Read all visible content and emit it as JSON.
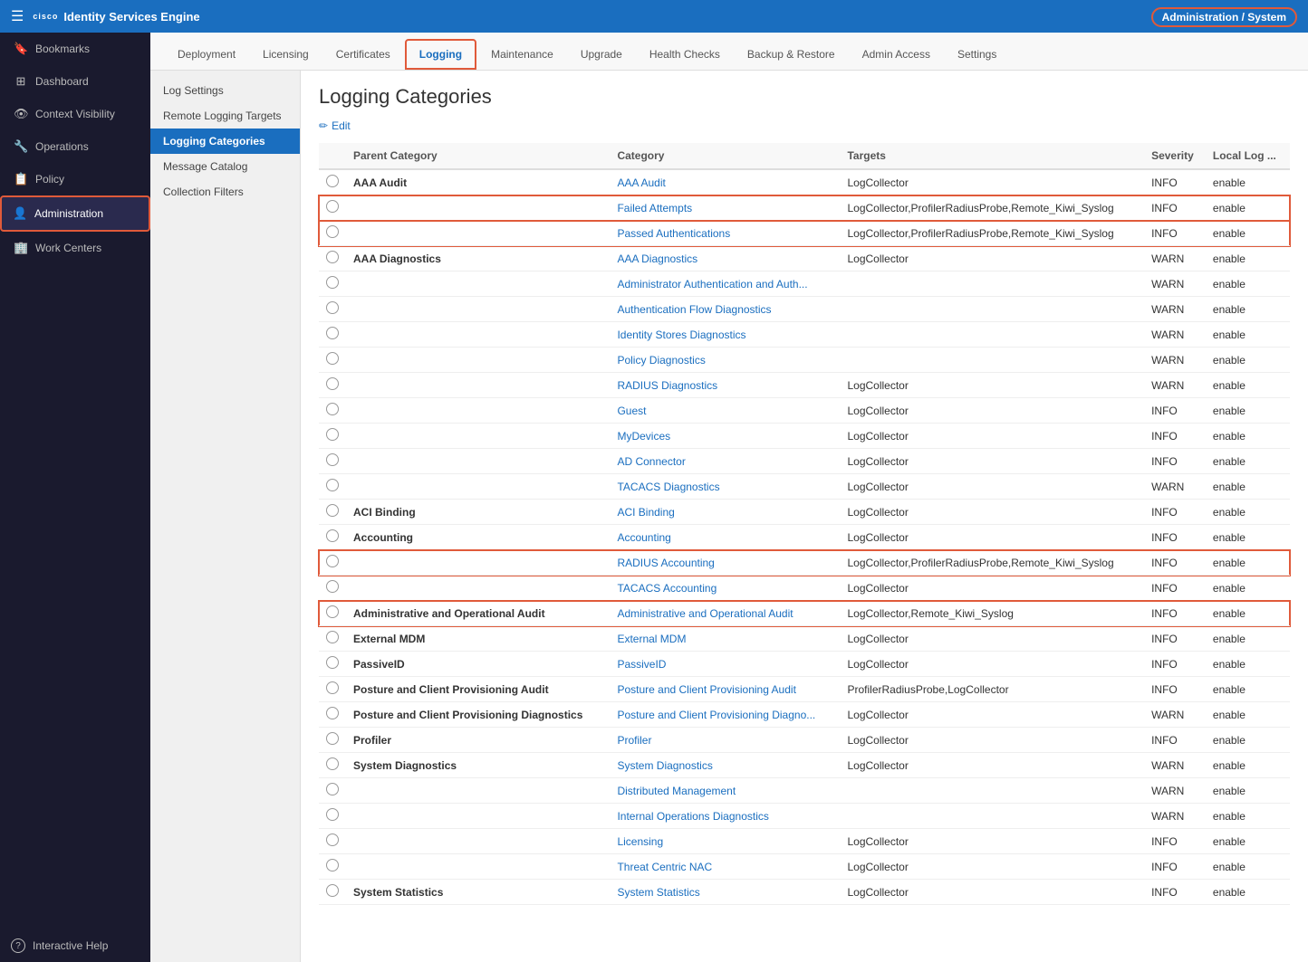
{
  "topBar": {
    "appName": "Identity Services Engine",
    "adminLabel": "Administration / System",
    "hamburgerSymbol": "☰",
    "ciscoLabel": "cisco"
  },
  "sidebar": {
    "items": [
      {
        "id": "bookmarks",
        "label": "Bookmarks",
        "icon": "🔖"
      },
      {
        "id": "dashboard",
        "label": "Dashboard",
        "icon": "⊞"
      },
      {
        "id": "context-visibility",
        "label": "Context Visibility",
        "icon": "👁"
      },
      {
        "id": "operations",
        "label": "Operations",
        "icon": "🔧"
      },
      {
        "id": "policy",
        "label": "Policy",
        "icon": "📋"
      },
      {
        "id": "administration",
        "label": "Administration",
        "icon": "👤",
        "active": true,
        "highlighted": true
      },
      {
        "id": "work-centers",
        "label": "Work Centers",
        "icon": "🏢"
      }
    ],
    "helpLabel": "Interactive Help",
    "helpIcon": "?"
  },
  "tabs": [
    {
      "id": "deployment",
      "label": "Deployment"
    },
    {
      "id": "licensing",
      "label": "Licensing"
    },
    {
      "id": "certificates",
      "label": "Certificates"
    },
    {
      "id": "logging",
      "label": "Logging",
      "active": true
    },
    {
      "id": "maintenance",
      "label": "Maintenance"
    },
    {
      "id": "upgrade",
      "label": "Upgrade"
    },
    {
      "id": "health-checks",
      "label": "Health Checks"
    },
    {
      "id": "backup-restore",
      "label": "Backup & Restore"
    },
    {
      "id": "admin-access",
      "label": "Admin Access"
    },
    {
      "id": "settings",
      "label": "Settings"
    }
  ],
  "subNav": {
    "items": [
      {
        "id": "log-settings",
        "label": "Log Settings"
      },
      {
        "id": "remote-logging",
        "label": "Remote Logging Targets"
      },
      {
        "id": "logging-categories",
        "label": "Logging Categories",
        "active": true
      },
      {
        "id": "message-catalog",
        "label": "Message Catalog"
      },
      {
        "id": "collection-filters",
        "label": "Collection Filters"
      }
    ]
  },
  "pageTitle": "Logging Categories",
  "editLabel": "Edit",
  "table": {
    "columns": [
      "",
      "Parent Category",
      "Category",
      "Targets",
      "Severity",
      "Local Log ..."
    ],
    "rows": [
      {
        "radio": true,
        "parent": "AAA Audit",
        "category": "AAA Audit",
        "targets": "LogCollector",
        "severity": "INFO",
        "localLog": "enable",
        "highlighted": false,
        "parentBold": true
      },
      {
        "radio": true,
        "parent": "",
        "category": "Failed Attempts",
        "targets": "LogCollector,ProfilerRadiusProbe,Remote_Kiwi_Syslog",
        "severity": "INFO",
        "localLog": "enable",
        "highlighted": true
      },
      {
        "radio": true,
        "parent": "",
        "category": "Passed Authentications",
        "targets": "LogCollector,ProfilerRadiusProbe,Remote_Kiwi_Syslog",
        "severity": "INFO",
        "localLog": "enable",
        "highlighted": true
      },
      {
        "radio": true,
        "parent": "AAA Diagnostics",
        "category": "AAA Diagnostics",
        "targets": "LogCollector",
        "severity": "WARN",
        "localLog": "enable",
        "highlighted": false,
        "parentBold": true
      },
      {
        "radio": true,
        "parent": "",
        "category": "Administrator Authentication and Auth...",
        "targets": "",
        "severity": "WARN",
        "localLog": "enable",
        "highlighted": false
      },
      {
        "radio": true,
        "parent": "",
        "category": "Authentication Flow Diagnostics",
        "targets": "",
        "severity": "WARN",
        "localLog": "enable",
        "highlighted": false
      },
      {
        "radio": true,
        "parent": "",
        "category": "Identity Stores Diagnostics",
        "targets": "",
        "severity": "WARN",
        "localLog": "enable",
        "highlighted": false
      },
      {
        "radio": true,
        "parent": "",
        "category": "Policy Diagnostics",
        "targets": "",
        "severity": "WARN",
        "localLog": "enable",
        "highlighted": false
      },
      {
        "radio": true,
        "parent": "",
        "category": "RADIUS Diagnostics",
        "targets": "LogCollector",
        "severity": "WARN",
        "localLog": "enable",
        "highlighted": false
      },
      {
        "radio": true,
        "parent": "",
        "category": "Guest",
        "targets": "LogCollector",
        "severity": "INFO",
        "localLog": "enable",
        "highlighted": false
      },
      {
        "radio": true,
        "parent": "",
        "category": "MyDevices",
        "targets": "LogCollector",
        "severity": "INFO",
        "localLog": "enable",
        "highlighted": false
      },
      {
        "radio": true,
        "parent": "",
        "category": "AD Connector",
        "targets": "LogCollector",
        "severity": "INFO",
        "localLog": "enable",
        "highlighted": false
      },
      {
        "radio": true,
        "parent": "",
        "category": "TACACS Diagnostics",
        "targets": "LogCollector",
        "severity": "WARN",
        "localLog": "enable",
        "highlighted": false
      },
      {
        "radio": true,
        "parent": "ACI Binding",
        "category": "ACI Binding",
        "targets": "LogCollector",
        "severity": "INFO",
        "localLog": "enable",
        "highlighted": false,
        "parentBold": true
      },
      {
        "radio": true,
        "parent": "Accounting",
        "category": "Accounting",
        "targets": "LogCollector",
        "severity": "INFO",
        "localLog": "enable",
        "highlighted": false,
        "parentBold": true
      },
      {
        "radio": true,
        "parent": "",
        "category": "RADIUS Accounting",
        "targets": "LogCollector,ProfilerRadiusProbe,Remote_Kiwi_Syslog",
        "severity": "INFO",
        "localLog": "enable",
        "highlighted": true
      },
      {
        "radio": true,
        "parent": "",
        "category": "TACACS Accounting",
        "targets": "LogCollector",
        "severity": "INFO",
        "localLog": "enable",
        "highlighted": false
      },
      {
        "radio": true,
        "parent": "Administrative and Operational Audit",
        "category": "Administrative and Operational Audit",
        "targets": "LogCollector,Remote_Kiwi_Syslog",
        "severity": "INFO",
        "localLog": "enable",
        "highlighted": true,
        "parentBold": true
      },
      {
        "radio": true,
        "parent": "External MDM",
        "category": "External MDM",
        "targets": "LogCollector",
        "severity": "INFO",
        "localLog": "enable",
        "highlighted": false,
        "parentBold": true
      },
      {
        "radio": true,
        "parent": "PassiveID",
        "category": "PassiveID",
        "targets": "LogCollector",
        "severity": "INFO",
        "localLog": "enable",
        "highlighted": false,
        "parentBold": true
      },
      {
        "radio": true,
        "parent": "Posture and Client Provisioning Audit",
        "category": "Posture and Client Provisioning Audit",
        "targets": "ProfilerRadiusProbe,LogCollector",
        "severity": "INFO",
        "localLog": "enable",
        "highlighted": false,
        "parentBold": true
      },
      {
        "radio": true,
        "parent": "Posture and Client Provisioning Diagnostics",
        "category": "Posture and Client Provisioning Diagno...",
        "targets": "LogCollector",
        "severity": "WARN",
        "localLog": "enable",
        "highlighted": false,
        "parentBold": true
      },
      {
        "radio": true,
        "parent": "Profiler",
        "category": "Profiler",
        "targets": "LogCollector",
        "severity": "INFO",
        "localLog": "enable",
        "highlighted": false,
        "parentBold": true
      },
      {
        "radio": true,
        "parent": "System Diagnostics",
        "category": "System Diagnostics",
        "targets": "LogCollector",
        "severity": "WARN",
        "localLog": "enable",
        "highlighted": false,
        "parentBold": true
      },
      {
        "radio": true,
        "parent": "",
        "category": "Distributed Management",
        "targets": "",
        "severity": "WARN",
        "localLog": "enable",
        "highlighted": false
      },
      {
        "radio": true,
        "parent": "",
        "category": "Internal Operations Diagnostics",
        "targets": "",
        "severity": "WARN",
        "localLog": "enable",
        "highlighted": false
      },
      {
        "radio": true,
        "parent": "",
        "category": "Licensing",
        "targets": "LogCollector",
        "severity": "INFO",
        "localLog": "enable",
        "highlighted": false
      },
      {
        "radio": true,
        "parent": "",
        "category": "Threat Centric NAC",
        "targets": "LogCollector",
        "severity": "INFO",
        "localLog": "enable",
        "highlighted": false
      },
      {
        "radio": true,
        "parent": "System Statistics",
        "category": "System Statistics",
        "targets": "LogCollector",
        "severity": "INFO",
        "localLog": "enable",
        "highlighted": false,
        "parentBold": true
      }
    ]
  }
}
